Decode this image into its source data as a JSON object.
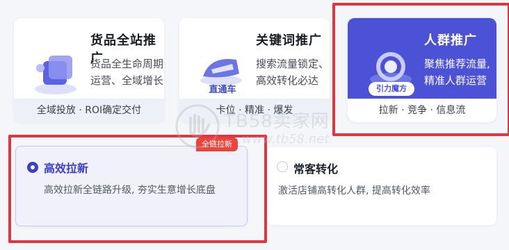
{
  "cards": [
    {
      "title": "货品全站推广",
      "desc": [
        "货品全生命周期",
        "运营、全域增长"
      ],
      "footer": "全域投放 · ROI确定交付"
    },
    {
      "title": "关键词推广",
      "desc": [
        "搜索流量锁定、",
        "高效转化必达"
      ],
      "footer": "卡位 · 精准 · 爆发",
      "icon_label": "直通车"
    },
    {
      "title": "人群推广",
      "desc": [
        "聚焦推荐流量,",
        "精准人群运营"
      ],
      "footer": "拉新 · 竞争 · 信息流",
      "icon_label": "引力魔方"
    }
  ],
  "options": [
    {
      "title": "高效拉新",
      "desc": "高效拉新全链路升级, 夯实生意增长底盘",
      "badge": "全链拉新",
      "selected": true
    },
    {
      "title": "常客转化",
      "desc": "激活店铺高转化人群, 提高转化效率",
      "selected": false
    }
  ],
  "watermark": {
    "text": "TB58卖家网",
    "url": "www.tb58.net"
  },
  "colors": {
    "accent": "#4b52d6",
    "highlight": "#e0363f",
    "badge": "#e8453c"
  }
}
